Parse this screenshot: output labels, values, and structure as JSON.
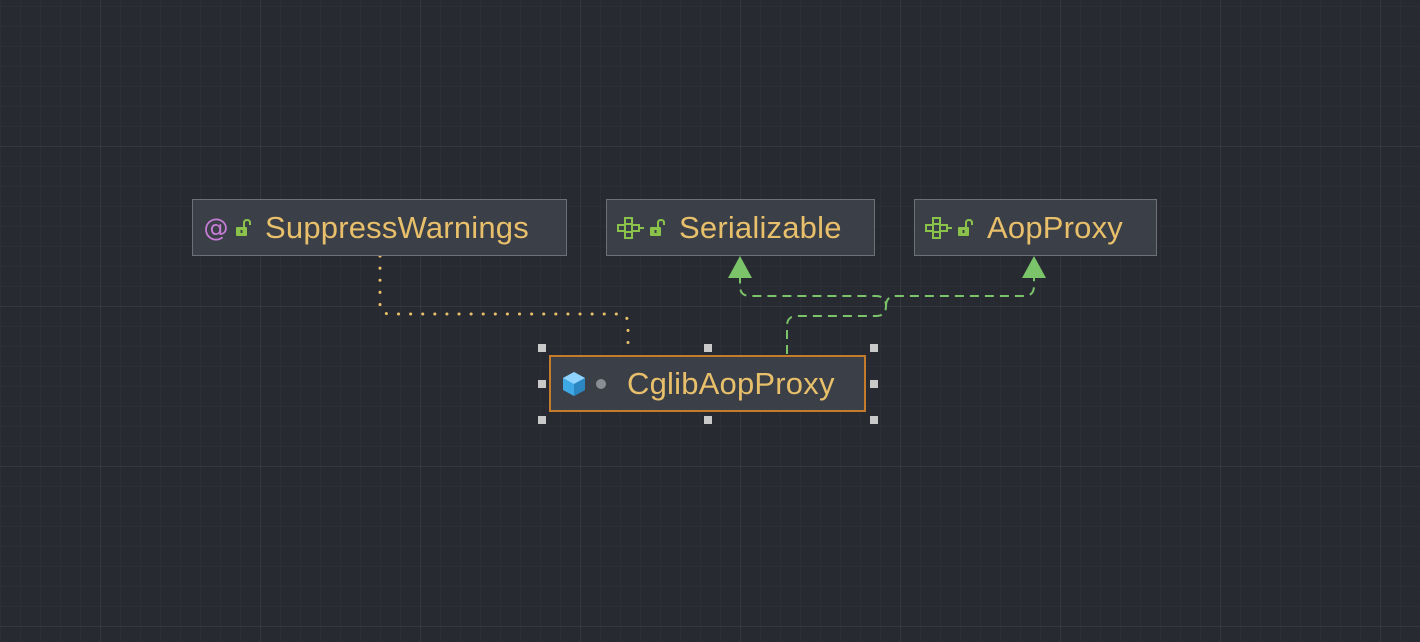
{
  "diagram": {
    "nodes": [
      {
        "id": "suppress",
        "label": "SuppressWarnings",
        "kind": "annotation",
        "visibility": "public",
        "icon": "annotation-icon"
      },
      {
        "id": "serializable",
        "label": "Serializable",
        "kind": "interface",
        "visibility": "public",
        "icon": "interface-icon"
      },
      {
        "id": "aopproxy",
        "label": "AopProxy",
        "kind": "interface",
        "visibility": "public",
        "icon": "interface-icon"
      },
      {
        "id": "cglib",
        "label": "CglibAopProxy",
        "kind": "class",
        "visibility": "package-private",
        "icon": "class-icon",
        "selected": true
      }
    ],
    "edges": [
      {
        "from": "cglib",
        "to": "suppress",
        "type": "annotation-usage",
        "style": "dotted",
        "color": "#e8bf6a"
      },
      {
        "from": "cglib",
        "to": "serializable",
        "type": "implements",
        "style": "dashed",
        "color": "#7cc46a"
      },
      {
        "from": "cglib",
        "to": "aopproxy",
        "type": "implements",
        "style": "dashed",
        "color": "#7cc46a"
      }
    ]
  },
  "colors": {
    "background": "#272a31",
    "node_fill": "#3b3f47",
    "node_border": "#6d7078",
    "selected_border": "#c47c2c",
    "label": "#e8bf6a",
    "annotation": "#c77dd6",
    "interface": "#8bc34a",
    "class": "#3fa9e6"
  }
}
